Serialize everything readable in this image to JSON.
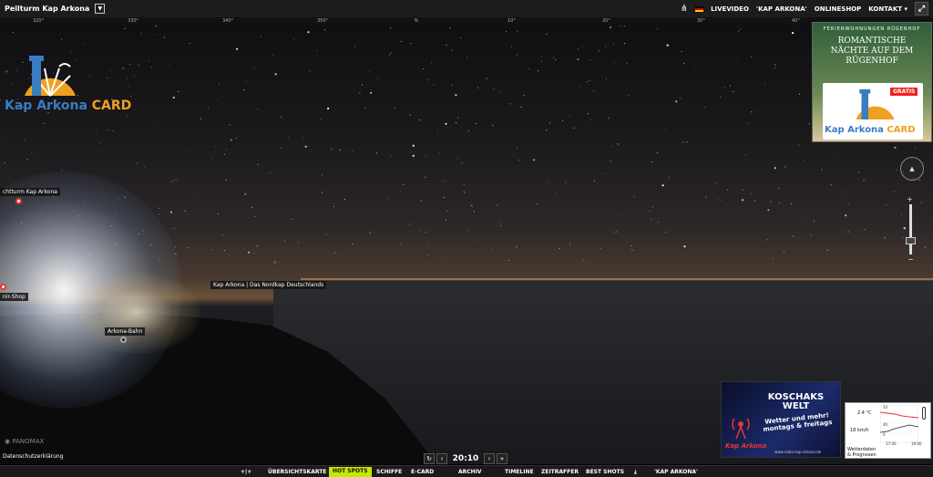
{
  "header": {
    "title": "Peilturm Kap Arkona",
    "nav": {
      "livevideo": "LIVEVIDEO",
      "kap_arkona": "'KAP ARKONA'",
      "onlineshop": "ONLINESHOP",
      "kontakt": "KONTAKT"
    }
  },
  "compass_ticks": [
    "320°",
    "330°",
    "340°",
    "350°",
    "N",
    "10°",
    "20°",
    "30°",
    "40°"
  ],
  "pois": {
    "leuchtturm": "chtturm Kap Arkona",
    "nordkap": "Kap Arkona | Das Nordkap Deutschlands",
    "shop": "nir-Shop",
    "bahn": "Arkona-Bahn"
  },
  "logo": {
    "name": "Kap Arkona",
    "card": "CARD"
  },
  "ad_top": {
    "line1": "FERIENWOHNUNGEN RÜGENHOF",
    "line2a": "ROMANTISCHE",
    "line2b": "NÄCHTE AUF DEM",
    "line2c": "RÜGENHOF",
    "gratis": "GRATIS",
    "card_name": "Kap Arkona",
    "card_word": "CARD"
  },
  "ad_bottom": {
    "title1": "KOSCHAKS",
    "title2": "WELT",
    "slogan1": "Wetter und mehr!",
    "slogan2": "montags & freitags",
    "brand": "Kap Arkona",
    "url": "www.radio-kap-arkona.de"
  },
  "weather": {
    "temp": "2.4 °C",
    "wind": "18 km/h",
    "label1": "Wetterdaten",
    "label2": "& Prognosen",
    "t1": "17:00",
    "t2": "19:00",
    "scale_top": "10",
    "scale_mid": "40",
    "scale_low": "0"
  },
  "footer": {
    "panomax": "PANOMAX",
    "privacy": "Datenschutzerklärung",
    "time": "20:10"
  },
  "bottom_menu": {
    "uebersicht": "ÜBERSICHTSKARTE",
    "hotspots": "HOT SPOTS",
    "schiffe": "SCHIFFE",
    "ecard": "E-CARD",
    "archiv": "ARCHIV",
    "timeline": "TIMELINE",
    "zeitraffer": "ZEITRAFFER",
    "bestshots": "BEST SHOTS",
    "kap": "'KAP ARKONA'"
  },
  "colors": {
    "accent": "#c7e600",
    "brand_blue": "#3a7cc2",
    "brand_orange": "#f0a020",
    "poi_dot": "#e33333"
  }
}
